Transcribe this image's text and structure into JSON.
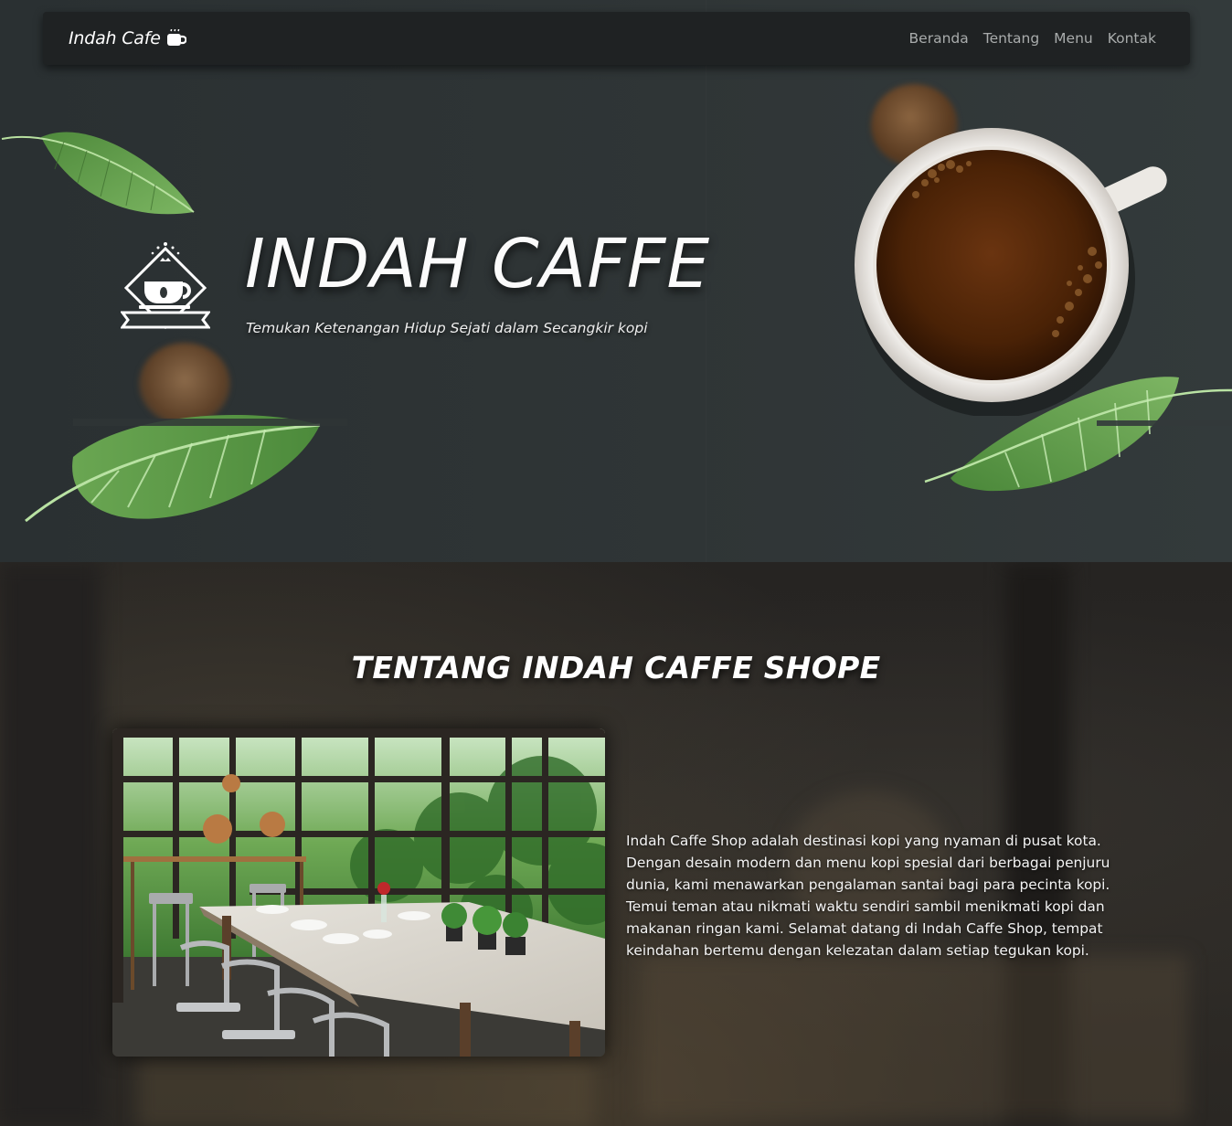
{
  "navbar": {
    "brand": "Indah Cafe",
    "brand_icon": "coffee-mug-icon",
    "links": [
      "Beranda",
      "Tentang",
      "Menu",
      "Kontak"
    ]
  },
  "hero": {
    "title": "INDAH CAFFE",
    "subtitle": "Temukan Ketenangan Hidup Sejati dalam Secangkir kopi",
    "logo_icon": "coffee-cup-emblem-icon"
  },
  "about": {
    "title": "TENTANG INDAH CAFFE SHOPE",
    "text": "Indah Caffe Shop adalah destinasi kopi yang nyaman di pusat kota. Dengan desain modern dan menu kopi spesial dari berbagai penjuru dunia, kami menawarkan pengalaman santai bagi para pecinta kopi. Temui teman atau nikmati waktu sendiri sambil menikmati kopi dan makanan ringan kami. Selamat datang di Indah Caffe Shop, tempat keindahan bertemu dengan kelezatan dalam setiap tegukan kopi."
  },
  "colors": {
    "hero_bg": "#2f3536",
    "navbar_bg": "#1f2223",
    "nav_link": "#a9acac",
    "leaf_green": "#5e9a4a",
    "coffee": "#4a2206"
  }
}
